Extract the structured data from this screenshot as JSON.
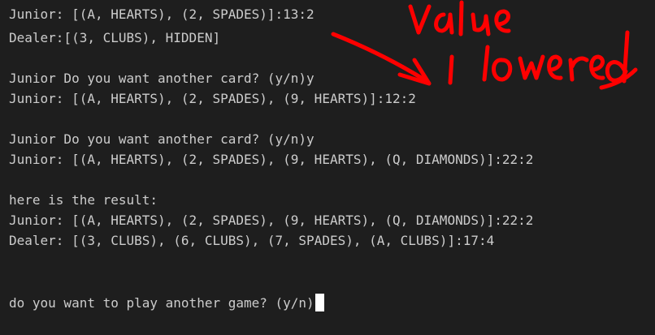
{
  "terminal": {
    "lines": [
      "Junior: [(A, HEARTS), (2, SPADES)]:13:2",
      "Dealer:[(3, CLUBS), HIDDEN]",
      "",
      "Junior Do you want another card? (y/n)y",
      "Junior: [(A, HEARTS), (2, SPADES), (9, HEARTS)]:12:2",
      "",
      "Junior Do you want another card? (y/n)y",
      "Junior: [(A, HEARTS), (2, SPADES), (9, HEARTS), (Q, DIAMONDS)]:22:2",
      "",
      "here is the result:",
      "Junior: [(A, HEARTS), (2, SPADES), (9, HEARTS), (Q, DIAMONDS)]:22:2",
      "Dealer: [(3, CLUBS), (6, CLUBS), (7, SPADES), (A, CLUBS)]:17:4"
    ],
    "prompt": "do you want to play another game? (y/n)"
  },
  "annotation": {
    "text_line1": "value",
    "text_line2": "lowered",
    "color": "#ff0000"
  },
  "colors": {
    "background": "#1e1e1e",
    "text": "#cccccc",
    "cursor": "#ffffff"
  }
}
